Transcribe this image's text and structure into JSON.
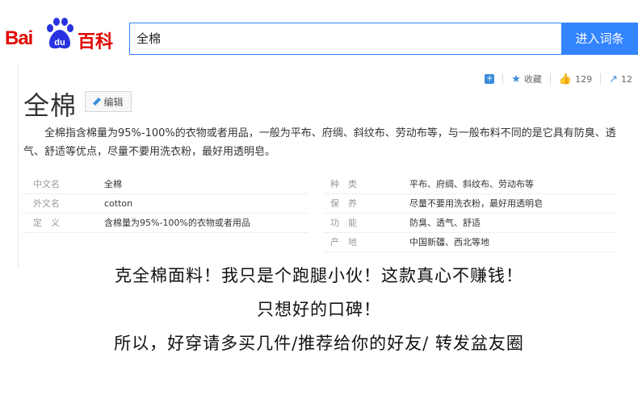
{
  "header": {
    "logo_text": "Bai",
    "logo_du": "du",
    "logo_baike": "百科",
    "search_value": "全棉",
    "search_button": "进入词条"
  },
  "actions": {
    "collect": "收藏",
    "likes": "129",
    "shares": "12"
  },
  "entry": {
    "title": "全棉",
    "edit_label": "编辑",
    "summary": "全棉指含棉量为95%-100%的衣物或者用品，一般为平布、府绸、斜纹布、劳动布等，与一般布料不同的是它具有防臭、透气、舒适等优点，尽量不要用洗衣粉，最好用透明皂。"
  },
  "info_left": [
    {
      "label": "中文名",
      "value": "全棉"
    },
    {
      "label": "外文名",
      "value": "cotton"
    },
    {
      "label": "定　义",
      "value": "含棉量为95%-100%的衣物或者用品"
    }
  ],
  "info_right": [
    {
      "label": "种　类",
      "value": "平布、府绸、斜纹布、劳动布等"
    },
    {
      "label": "保　养",
      "value": "尽量不要用洗衣粉，最好用透明皂"
    },
    {
      "label": "功　能",
      "value": "防臭、透气、舒适"
    },
    {
      "label": "产　地",
      "value": "中国新疆、西北等地"
    }
  ],
  "slogan": {
    "line1": "克全棉面料！我只是个跑腿小伙！这款真心不赚钱！",
    "line2": "只想好的口碑！",
    "line3": "所以，好穿请多买几件/推荐给你的好友/ 转发盆友圈"
  },
  "colors": {
    "brand_red": "#e10601",
    "brand_blue": "#2932e1",
    "search_blue": "#3385ff"
  }
}
